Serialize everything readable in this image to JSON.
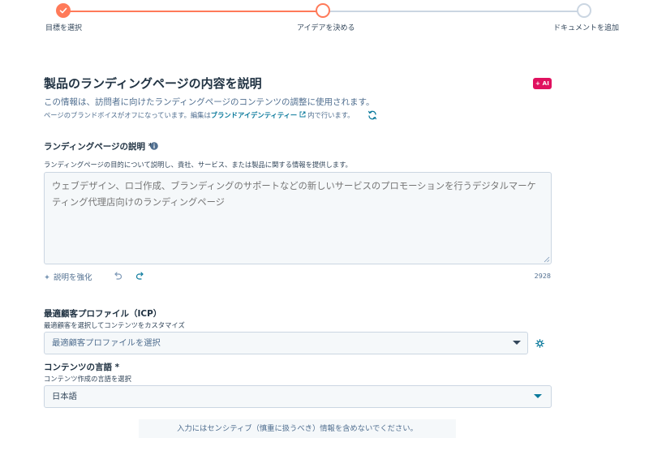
{
  "stepper": {
    "steps": [
      {
        "label": "目標を選択",
        "state": "complete"
      },
      {
        "label": "アイデアを決める",
        "state": "current"
      },
      {
        "label": "ドキュメントを追加",
        "state": "pending"
      }
    ],
    "accent_color": "#ff7a59"
  },
  "header": {
    "title": "製品のランディングページの内容を説明",
    "ai_badge": "+ AI",
    "subtitle": "この情報は、訪問者に向けたランディングページのコンテンツの調整に使用されます。",
    "voice_note_prefix": "ページのブランドボイスがオフになっています。編集は",
    "voice_note_link": "ブランドアイデンティティー",
    "voice_note_suffix": "内で行います。"
  },
  "description": {
    "label": "ランディングページの説明 *",
    "help": "ランディングページの目的について説明し、貴社、サービス、または製品に関する情報を提供します。",
    "placeholder": "ウェブデザイン、ロゴ作成、ブランディングのサポートなどの新しいサービスのプロモーションを行うデジタルマーケティング代理店向けのランディングページ",
    "value": "",
    "enhance_label": "説明を強化",
    "char_count": "2928"
  },
  "icp": {
    "label": "最適顧客プロファイル（ICP）",
    "help": "最適顧客を選択してコンテンツをカスタマイズ",
    "placeholder": "最適顧客プロファイルを選択"
  },
  "language": {
    "label": "コンテンツの言語 *",
    "help": "コンテンツ作成の言語を選択",
    "value": "日本語"
  },
  "footer": {
    "notice": "入力にはセンシティブ（慎重に扱うべき）情報を含めないでください。"
  },
  "colors": {
    "link": "#0b7a9c",
    "ai_badge": "#e0115f",
    "field_bg": "#f5f8fa",
    "border": "#cbd6e2"
  }
}
